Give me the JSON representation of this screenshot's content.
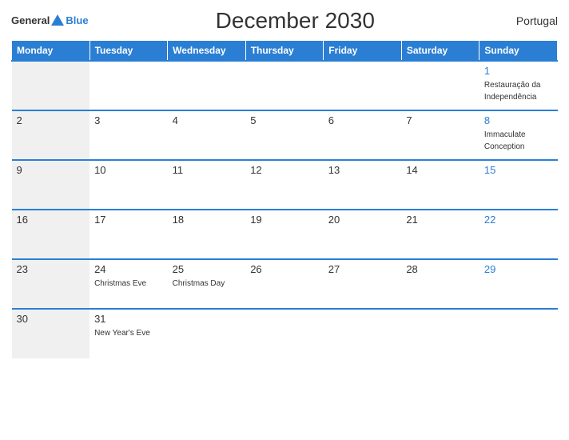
{
  "header": {
    "logo_general": "General",
    "logo_blue": "Blue",
    "title": "December 2030",
    "country": "Portugal"
  },
  "days_header": [
    "Monday",
    "Tuesday",
    "Wednesday",
    "Thursday",
    "Friday",
    "Saturday",
    "Sunday"
  ],
  "weeks": [
    [
      {
        "day": "",
        "event": ""
      },
      {
        "day": "",
        "event": ""
      },
      {
        "day": "",
        "event": ""
      },
      {
        "day": "",
        "event": ""
      },
      {
        "day": "",
        "event": ""
      },
      {
        "day": "",
        "event": ""
      },
      {
        "day": "1",
        "event": "Restauração da Independência"
      }
    ],
    [
      {
        "day": "2",
        "event": ""
      },
      {
        "day": "3",
        "event": ""
      },
      {
        "day": "4",
        "event": ""
      },
      {
        "day": "5",
        "event": ""
      },
      {
        "day": "6",
        "event": ""
      },
      {
        "day": "7",
        "event": ""
      },
      {
        "day": "8",
        "event": "Immaculate Conception"
      }
    ],
    [
      {
        "day": "9",
        "event": ""
      },
      {
        "day": "10",
        "event": ""
      },
      {
        "day": "11",
        "event": ""
      },
      {
        "day": "12",
        "event": ""
      },
      {
        "day": "13",
        "event": ""
      },
      {
        "day": "14",
        "event": ""
      },
      {
        "day": "15",
        "event": ""
      }
    ],
    [
      {
        "day": "16",
        "event": ""
      },
      {
        "day": "17",
        "event": ""
      },
      {
        "day": "18",
        "event": ""
      },
      {
        "day": "19",
        "event": ""
      },
      {
        "day": "20",
        "event": ""
      },
      {
        "day": "21",
        "event": ""
      },
      {
        "day": "22",
        "event": ""
      }
    ],
    [
      {
        "day": "23",
        "event": ""
      },
      {
        "day": "24",
        "event": "Christmas Eve"
      },
      {
        "day": "25",
        "event": "Christmas Day"
      },
      {
        "day": "26",
        "event": ""
      },
      {
        "day": "27",
        "event": ""
      },
      {
        "day": "28",
        "event": ""
      },
      {
        "day": "29",
        "event": ""
      }
    ],
    [
      {
        "day": "30",
        "event": ""
      },
      {
        "day": "31",
        "event": "New Year's Eve"
      },
      {
        "day": "",
        "event": ""
      },
      {
        "day": "",
        "event": ""
      },
      {
        "day": "",
        "event": ""
      },
      {
        "day": "",
        "event": ""
      },
      {
        "day": "",
        "event": ""
      }
    ]
  ]
}
